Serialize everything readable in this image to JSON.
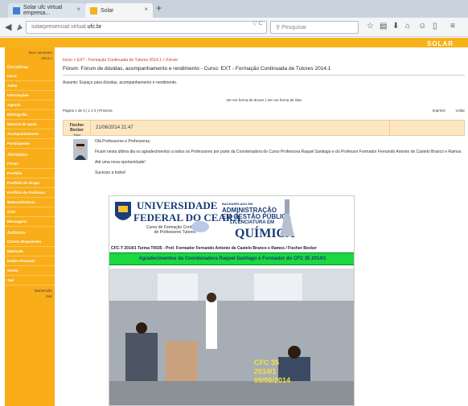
{
  "browser": {
    "tabs": [
      {
        "label": "Solar ufc virtual empresa...",
        "close": "×"
      },
      {
        "label": "Solar",
        "close": "×"
      }
    ],
    "new_tab": "+",
    "back": "◀",
    "url_prefix": "solarpresencial.virtual.",
    "url_domain": "ufc.br",
    "url_controls": "▽ C",
    "search_placeholder": "Pesquisar",
    "toolbar_icons": [
      "☆",
      "▤",
      "⬇",
      "⌂",
      "☺",
      "▯",
      "≡"
    ]
  },
  "site": {
    "logo_text": "SOLAR"
  },
  "sidebar": {
    "header_lines": [
      "Bom semestre",
      "2014.1"
    ],
    "sections": [
      {
        "title": "Disciplinas",
        "items": [
          "Início",
          "Aulas",
          "Informações",
          "Agenda",
          "Bibliografia",
          "Material de apoio",
          "Acompanhamento",
          "Participantes"
        ]
      },
      {
        "title": "Atividades",
        "items": [
          "Fórum",
          "Portfólio",
          "Portfólio do Grupo",
          "Portfólio do Professor",
          "Webconferência",
          "Chat",
          "Mensagens"
        ]
      },
      {
        "title": "Ambiente",
        "items": [
          "Cursos Disponíveis",
          "Matrícula",
          "Dados Pessoais",
          "Senha",
          "Sair"
        ]
      }
    ],
    "footer_lines": [
      "Mantenção",
      "Sair"
    ]
  },
  "forum": {
    "breadcrumb": "Início > EXT - Formação Continuada de Tutores 2014.1 > Fórum",
    "title": "Fórum: Fórum de dúvidas, acompanhamento e rendimento - Curso: EXT - Formação Continuada de Tutores 2014.1",
    "subject": "Assunto: Espaço para dúvidas, acompanhamento e rendimento.",
    "view_links": "Ver em forma de árvore  |  Ver em forma de lista",
    "pagination": "Página 1 de 3  |  1  2  3  |  Próxima",
    "right_actions": [
      "Imprimir",
      "Voltar"
    ]
  },
  "post": {
    "author": "Fischer Becker",
    "author_role": "Tutor",
    "date": "21/06/2014 21:47",
    "paragraphs": [
      "Olá Professores e Professoras.",
      "Ficam nesta última dia os agradecimentos a todos os Professores por parte da Coordenadora do Curso Professora Raquel Santiago e do Professor Formador Fernando Antonio de Castelo Branco e Ramos.",
      "Até uma nova oportunidade!",
      "Sucesso a todos!"
    ]
  },
  "banner": {
    "ufc_title_1": "UNIVERSIDADE",
    "ufc_title_2": "FEDERAL DO CEARÁ",
    "ufc_sub": "Curso de Formação Continuada\nde Professores Tutores",
    "adm_line1": "BACHARELADO EM",
    "adm_line2": "ADMINISTRAÇÃO",
    "adm_line3": "EM GESTÃO PÚBLICA",
    "lic_line": "LICENCIATURA EM",
    "quimica": "QUÍMICA",
    "course_line": "CFC-T 2014/1 Turma T0035 - Prof. Formador Fernando Antonio de Castelo Branco e Ramos / Fischer Becker",
    "green_bar": "Agradecimentos da Coordenadora Raquel Santiago e Formador do CFC 35 2014/1",
    "caption_lines": [
      "CFC 35",
      "2014/1",
      "09/06/2014"
    ]
  }
}
